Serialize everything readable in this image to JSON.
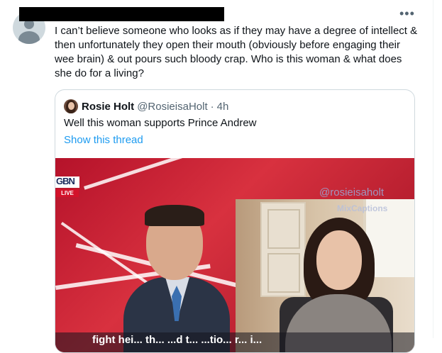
{
  "tweet": {
    "author_redacted": true,
    "more_label": "•••",
    "text": "I can’t believe someone who looks as if they may have a degree of intellect & then unfortunately they open their mouth (obviously before engaging their wee brain) & out pours such bloody crap. Who is this woman & what does she do for a living?"
  },
  "quoted_tweet": {
    "name": "Rosie Holt",
    "handle": "@RosieisaHolt",
    "dot": "·",
    "time": "4h",
    "text": "Well this woman supports Prince Andrew",
    "show_thread": "Show this thread"
  },
  "video": {
    "logo_text": "GBN",
    "live_label": "LIVE",
    "watermark": "@rosieisaholt",
    "watermark2": "MixCaptions",
    "subtitle": "fight hei... th... ...d t... ...tio... r... i..."
  },
  "colors": {
    "link": "#1d9bf0",
    "text": "#0f1419",
    "secondary": "#536471",
    "border": "#cfd9de"
  }
}
